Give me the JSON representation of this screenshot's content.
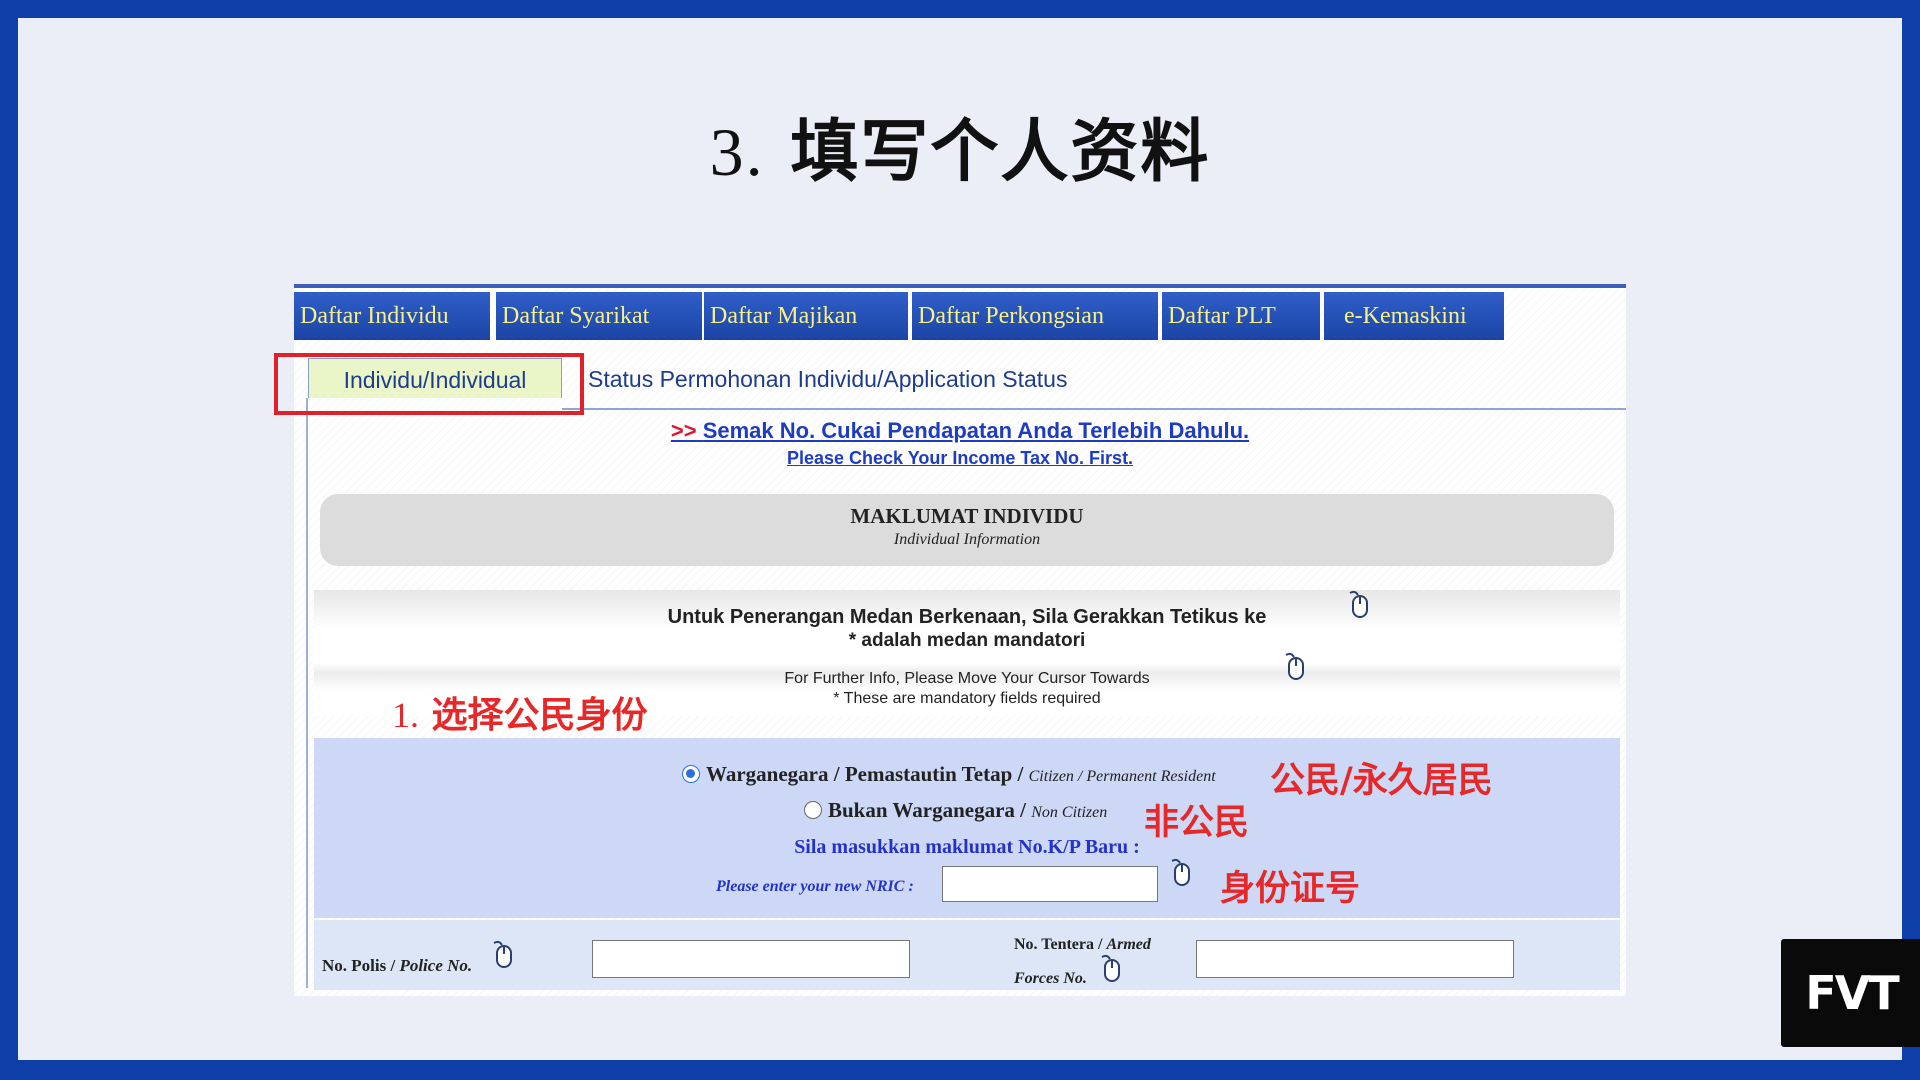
{
  "slide": {
    "title_number": "3.",
    "title_text": "填写个人资料"
  },
  "menu": {
    "tabs": [
      "Daftar Individu",
      "Daftar Syarikat",
      "Daftar Majikan",
      "Daftar Perkongsian",
      "Daftar PLT",
      "e-Kemaskini"
    ]
  },
  "subtabs": {
    "active": "Individu/Individual",
    "other": "Status Permohonan Individu/Application Status"
  },
  "links": {
    "arrow": ">>",
    "check_tax_my": "Semak No. Cukai Pendapatan Anda Terlebih Dahulu.",
    "check_tax_en": "Please Check Your Income Tax No. First."
  },
  "section": {
    "title": "MAKLUMAT INDIVIDU",
    "subtitle": "Individual Information"
  },
  "help": {
    "my_line1": "Untuk Penerangan Medan Berkenaan, Sila Gerakkan Tetikus ke",
    "my_line2": "* adalah medan mandatori",
    "en_line1": "For Further Info, Please Move Your Cursor Towards",
    "en_line2": "* These are mandatory fields required"
  },
  "citizenship": {
    "options": [
      {
        "label_my": "Warganegara / Pemastautin Tetap /",
        "label_en": "Citizen / Permanent Resident",
        "checked": true
      },
      {
        "label_my": "Bukan Warganegara /",
        "label_en": "Non Citizen",
        "checked": false
      }
    ],
    "nric_label_my": "Sila masukkan maklumat No.K/P Baru :",
    "nric_label_en": "Please enter your new NRIC :",
    "nric_value": ""
  },
  "police": {
    "label_my": "No. Polis /",
    "label_en": "Police No.",
    "value": ""
  },
  "armed": {
    "label_my": "No. Tentera /",
    "label_en": "Armed Forces No.",
    "value": ""
  },
  "annotations": {
    "step_number": "1.",
    "step_text": "选择公民身份",
    "citizen": "公民/永久居民",
    "non_citizen": "非公民",
    "nric": "身份证号"
  },
  "logo": {
    "text": "FVT"
  },
  "colors": {
    "border_blue": "#0e3fa8",
    "menu_blue": "#1c44a6",
    "menu_text": "#f6f08a",
    "annotation_red": "#e62828",
    "panel_blue": "#cdd8f6"
  },
  "icons": {
    "help": "mouse-icon"
  }
}
